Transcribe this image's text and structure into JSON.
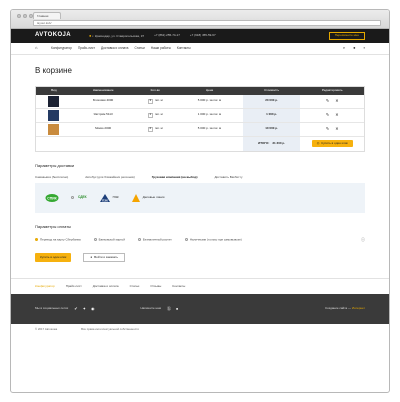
{
  "browser": {
    "tab": "Главная",
    "url": "layout.kub/"
  },
  "topbar": {
    "logo": "AVTOKOJA",
    "address": "г. Краснодар, ул. Ставропольская, 37",
    "phone1": "+7 (861) 255-74-17",
    "phone2": "+7 (918) 455-59-67",
    "callback": "Перезвоните мне"
  },
  "nav": {
    "items": [
      "Конфигуратор",
      "Прайс-лист",
      "Доставка и оплата",
      "Статьи",
      "Наши работы",
      "Контакты"
    ]
  },
  "page_title": "В корзине",
  "cart": {
    "headers": [
      "Вид",
      "Наименование",
      "Кол-во",
      "Цена",
      "Стоимость",
      "Редактировать"
    ],
    "rows": [
      {
        "name": "Блоговик 4000",
        "qty": "3",
        "unit": "пог. м",
        "price": "5 000 р. за пог. м",
        "cost": "20 000 р.",
        "color": "#1c2233"
      },
      {
        "name": "Экстрим 5113",
        "qty": "1",
        "unit": "пог. м",
        "price": "1 000 р. за пог. м",
        "cost": "1 000 р.",
        "color": "#243a63"
      },
      {
        "name": "Мокко 2000",
        "qty": "2",
        "unit": "пог. м",
        "price": "5 000 р. за пог. м",
        "cost": "10 000 р.",
        "color": "#c98b3e"
      }
    ],
    "total_label": "ИТОГО:",
    "total_value": "31 300 р.",
    "buy_one_click": "Купить в один клик"
  },
  "delivery": {
    "title": "Параметры доставки",
    "tabs": [
      "Самовывоз (бесплатно)",
      "Автобус (для ближайших регионов)",
      "Грузовая компания (на выбор)",
      "Доставить Вахбитту"
    ],
    "active_tab": 2,
    "carriers": [
      {
        "name": "СПИК",
        "color": "#35a832"
      },
      {
        "name": "СДЕК",
        "color": "#2f8f2f"
      },
      {
        "name": "ПЭК",
        "color": "#1d3f7a"
      },
      {
        "name": "Деловые линии",
        "color": "#f5a400"
      }
    ]
  },
  "payment": {
    "title": "Параметры оплаты",
    "options": [
      "Перевод на карту Сбербанка",
      "Банковской картой",
      "Безналичный расчет",
      "Наличными (только при самовывозе)"
    ],
    "selected": 0,
    "buy_button": "Купить в один клик",
    "login_button": "Войти и заказать"
  },
  "footer": {
    "nav": [
      "Конфигуратор",
      "Прайс-лист",
      "Доставка и оплата",
      "Статьи",
      "Отзывы",
      "Контакты"
    ],
    "social_label": "Мы в социальных сетях",
    "contact_label": "Напишите нам",
    "made_by": "Создание сайта —",
    "made_by_link": "Интернет",
    "copyright": "© 2017 Автокожа",
    "rights": "Все права интеллектуальной собственности"
  }
}
